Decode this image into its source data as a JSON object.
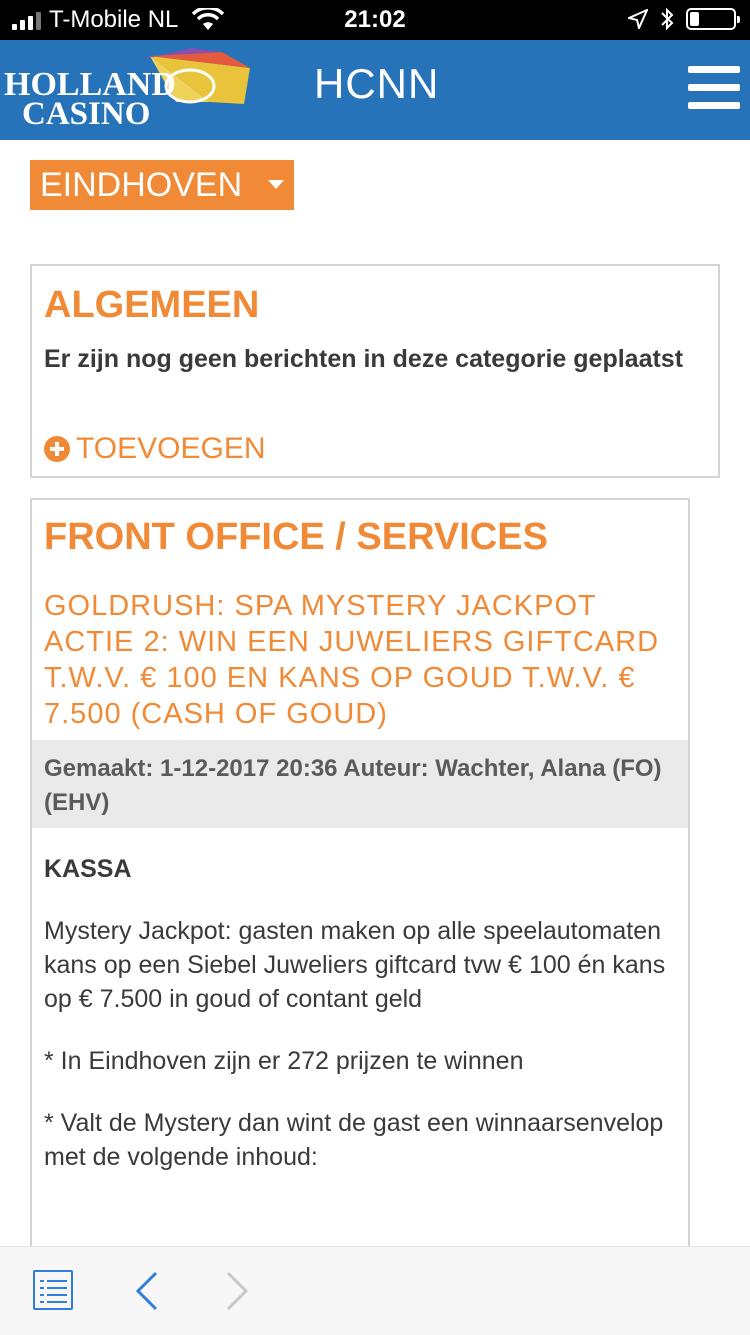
{
  "status_bar": {
    "carrier": "T-Mobile NL",
    "time": "21:02"
  },
  "header": {
    "logo_line1": "HOLLAND",
    "logo_line2": "CASINO",
    "title": "HCNN"
  },
  "location": {
    "selected": "EINDHOVEN"
  },
  "categories": [
    {
      "title": "ALGEMEEN",
      "empty_message": "Er zijn nog geen berichten in deze categorie geplaatst",
      "add_label": "TOEVOEGEN"
    },
    {
      "title": "FRONT OFFICE / SERVICES",
      "post": {
        "title": "GOLDRUSH: SPA MYSTERY JACKPOT ACTIE 2: WIN EEN JUWELIERS GIFTCARD T.W.V. € 100 EN KANS OP GOUD T.W.V. € 7.500 (CASH OF GOUD)",
        "meta": "Gemaakt: 1-12-2017 20:36 Auteur: Wachter, Alana (FO) (EHV)",
        "section": "KASSA",
        "paragraphs": [
          "Mystery Jackpot: gasten maken op alle speelautomaten kans op een Siebel Juweliers giftcard tvw € 100 én kans op € 7.500 in goud of contant geld",
          "* In Eindhoven zijn er 272 prijzen te winnen",
          "* Valt de Mystery dan wint de gast een winnaarsenvelop met de volgende inhoud:"
        ]
      }
    }
  ],
  "colors": {
    "header_blue": "#2673b9",
    "accent_orange": "#f08a36",
    "toolbar_blue": "#2f7de1"
  }
}
